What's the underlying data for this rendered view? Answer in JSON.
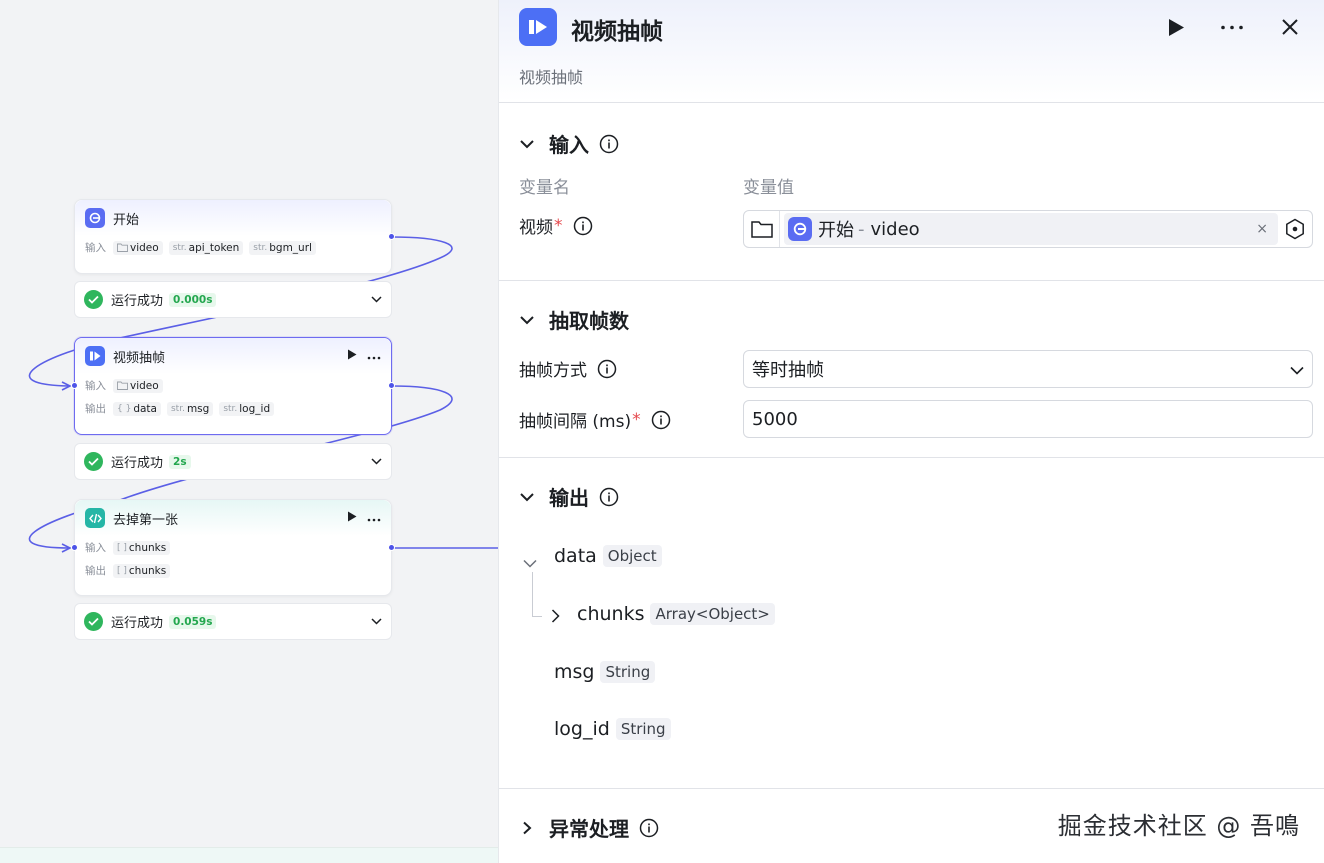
{
  "canvas": {
    "nodes": [
      {
        "id": "start",
        "title": "开始",
        "icon": "start-icon",
        "io": [
          {
            "label": "输入",
            "items": [
              {
                "type": "folder",
                "type_text": "",
                "name": "video"
              },
              {
                "type": "str",
                "type_text": "str.",
                "name": "api_token"
              },
              {
                "type": "str",
                "type_text": "str.",
                "name": "bgm_url"
              }
            ]
          }
        ],
        "status": {
          "label": "运行成功",
          "time": "0.000s"
        }
      },
      {
        "id": "video-frame",
        "title": "视频抽帧",
        "icon": "video-frame-icon",
        "io": [
          {
            "label": "输入",
            "items": [
              {
                "type": "folder",
                "type_text": "",
                "name": "video"
              }
            ]
          },
          {
            "label": "输出",
            "items": [
              {
                "type": "obj",
                "type_text": "{ }",
                "name": "data"
              },
              {
                "type": "str",
                "type_text": "str.",
                "name": "msg"
              },
              {
                "type": "str",
                "type_text": "str.",
                "name": "log_id"
              }
            ]
          }
        ],
        "status": {
          "label": "运行成功",
          "time": "2s"
        }
      },
      {
        "id": "remove-first",
        "title": "去掉第一张",
        "icon": "code-icon",
        "io": [
          {
            "label": "输入",
            "items": [
              {
                "type": "arr",
                "type_text": "[ ]",
                "name": "chunks"
              }
            ]
          },
          {
            "label": "输出",
            "items": [
              {
                "type": "arr",
                "type_text": "[ ]",
                "name": "chunks"
              }
            ]
          }
        ],
        "status": {
          "label": "运行成功",
          "time": "0.059s"
        }
      }
    ]
  },
  "panel": {
    "title": "视频抽帧",
    "description": "视频抽帧",
    "input_section": {
      "title": "输入",
      "col_name": "变量名",
      "col_value": "变量值",
      "var_label": "视频",
      "ref_node": "开始",
      "ref_sep": "-",
      "ref_var": "video",
      "clear_glyph": "×"
    },
    "frame_section": {
      "title": "抽取帧数",
      "mode_label": "抽帧方式",
      "mode_value": "等时抽帧",
      "interval_label": "抽帧间隔 (ms)",
      "interval_value": "5000"
    },
    "output_section": {
      "title": "输出",
      "fields": [
        {
          "name": "data",
          "type": "Object"
        },
        {
          "name": "chunks",
          "type": "Array<Object>"
        },
        {
          "name": "msg",
          "type": "String"
        },
        {
          "name": "log_id",
          "type": "String"
        }
      ]
    },
    "error_section": {
      "title": "异常处理"
    },
    "required_mark": "*"
  },
  "watermark": "掘金技术社区 @ 吾鳴",
  "colors": {
    "accent": "#4d53e8",
    "success": "#2fb65d",
    "required": "#e5484d",
    "video_icon_bg": "#4c6ff5",
    "code_icon_bg": "#25b6a6"
  }
}
